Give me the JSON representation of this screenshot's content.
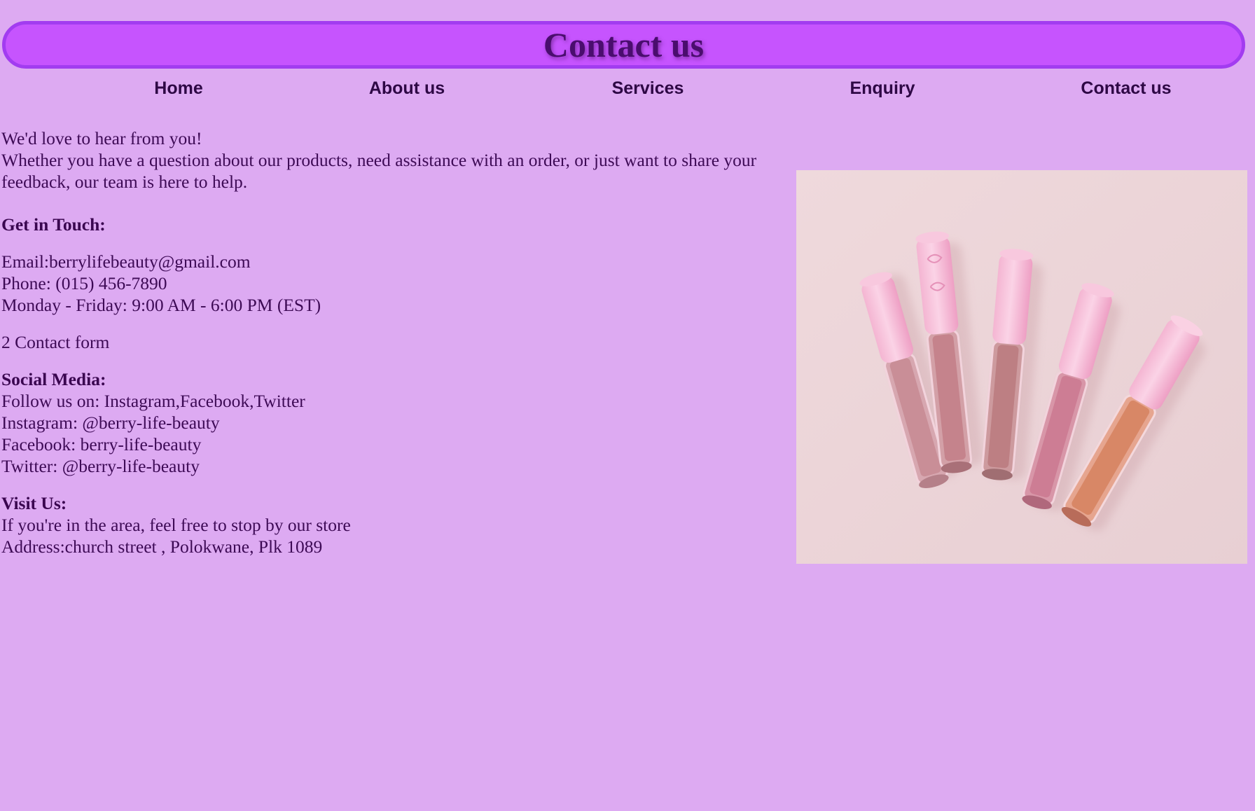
{
  "header": {
    "title": "Contact us"
  },
  "nav": {
    "items": [
      {
        "label": "Home"
      },
      {
        "label": "About us"
      },
      {
        "label": "Services"
      },
      {
        "label": "Enquiry"
      },
      {
        "label": "Contact us"
      }
    ]
  },
  "intro": {
    "greeting": "We'd love to hear from you!",
    "body": "Whether you have a question about our products, need assistance with an order, or just want to share your feedback, our team is here to help."
  },
  "contact": {
    "heading": "Get in Touch:",
    "email": "Email:berrylifebeauty@gmail.com",
    "phone": "Phone: (015) 456-7890",
    "hours": "Monday - Friday: 9:00 AM - 6:00 PM (EST)"
  },
  "contact_form": {
    "label": "2 Contact form"
  },
  "social": {
    "heading": "Social Media:",
    "follow": "Follow us on: Instagram,Facebook,Twitter",
    "instagram": "Instagram: @berry-life-beauty",
    "facebook": "Facebook: berry-life-beauty",
    "twitter": "Twitter: @berry-life-beauty"
  },
  "visit": {
    "heading": "Visit Us:",
    "text": "If you're in the area, feel free to stop by our store",
    "address": "Address:church street , Polokwane, Plk 1089"
  },
  "colors": {
    "page_background": "#ddaaf2",
    "banner_fill": "#c654fe",
    "banner_border": "#a23cf0",
    "title_text": "#4a0d6e",
    "nav_text": "#2e0845",
    "body_text": "#3d0a55"
  },
  "image": {
    "subject": "lip-gloss-tubes-photo"
  }
}
